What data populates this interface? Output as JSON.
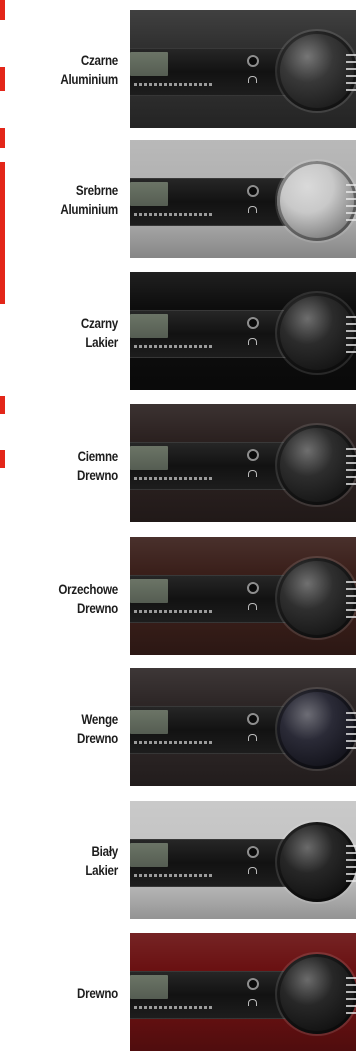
{
  "finishes": [
    {
      "line1": "Czarne",
      "line2": "Aluminium",
      "face": "#303030",
      "knob": "#2d2d2d"
    },
    {
      "line1": "Srebrne",
      "line2": "Aluminium",
      "face": "#b3b3b3",
      "knob": "#c6c6c6"
    },
    {
      "line1": "Czarny",
      "line2": "Lakier",
      "face": "#0d0d0d",
      "knob": "#202020"
    },
    {
      "line1": "Ciemne",
      "line2": "Drewno",
      "face": "#2b2120",
      "knob": "#222222"
    },
    {
      "line1": "Orzechowe",
      "line2": "Drewno",
      "face": "#3a1f1a",
      "knob": "#242424"
    },
    {
      "line1": "Wenge",
      "line2": "Drewno",
      "face": "#2d2626",
      "knob": "#1f1f2c"
    },
    {
      "line1": "Biały",
      "line2": "Lakier",
      "face": "#c5c5c5",
      "knob": "#1b1b1b"
    },
    {
      "line1": "Drewno",
      "line2": "",
      "face": "#6a1112",
      "knob": "#1c1c1c"
    }
  ],
  "accent_color": "#e32619"
}
